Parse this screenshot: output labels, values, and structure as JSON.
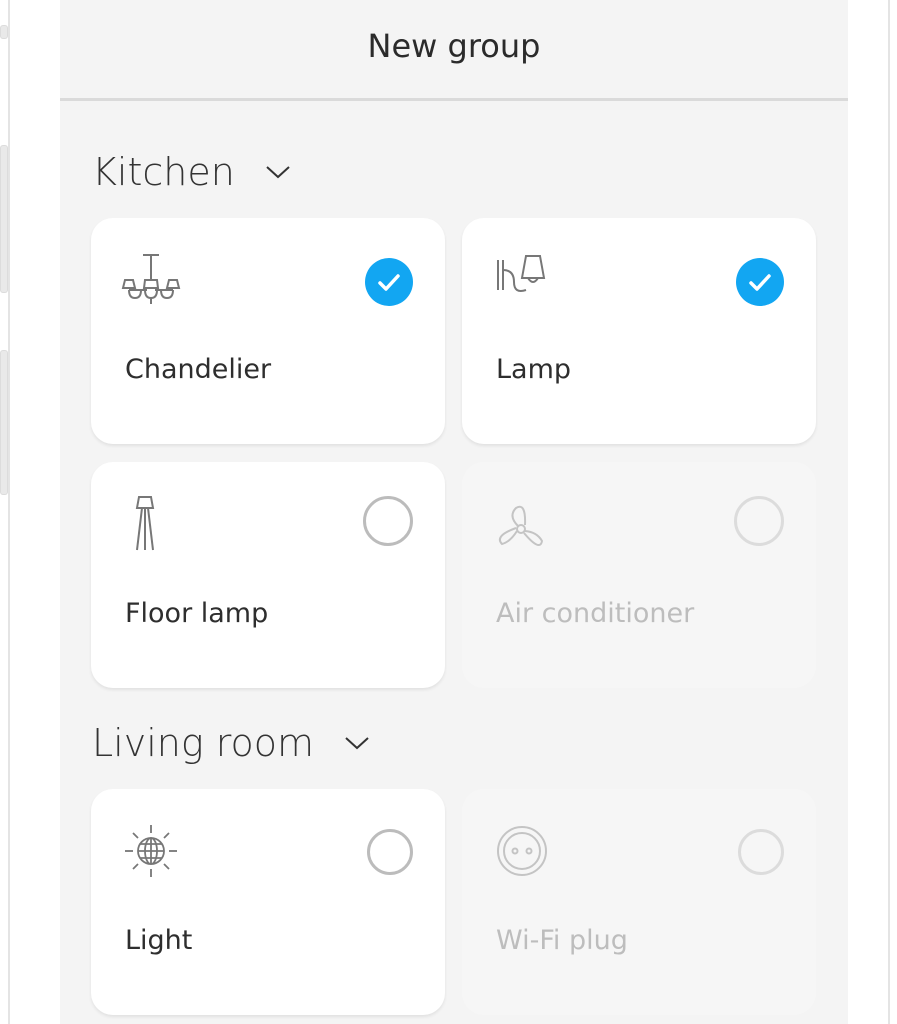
{
  "header": {
    "title": "New group"
  },
  "colors": {
    "accent": "#12a6f2",
    "background": "#f4f4f4",
    "card": "#ffffff",
    "disabled_text": "#bdbdbd"
  },
  "sections": [
    {
      "title": "Kitchen",
      "devices": [
        {
          "label": "Chandelier",
          "icon": "chandelier-icon",
          "selected": true,
          "enabled": true
        },
        {
          "label": "Lamp",
          "icon": "wall-lamp-icon",
          "selected": true,
          "enabled": true
        },
        {
          "label": "Floor lamp",
          "icon": "floor-lamp-icon",
          "selected": false,
          "enabled": true
        },
        {
          "label": "Air conditioner",
          "icon": "fan-icon",
          "selected": false,
          "enabled": false
        }
      ]
    },
    {
      "title": "Living room",
      "devices": [
        {
          "label": "Light",
          "icon": "light-bulb-icon",
          "selected": false,
          "enabled": true
        },
        {
          "label": "Wi-Fi plug",
          "icon": "socket-icon",
          "selected": false,
          "enabled": false
        }
      ]
    }
  ]
}
